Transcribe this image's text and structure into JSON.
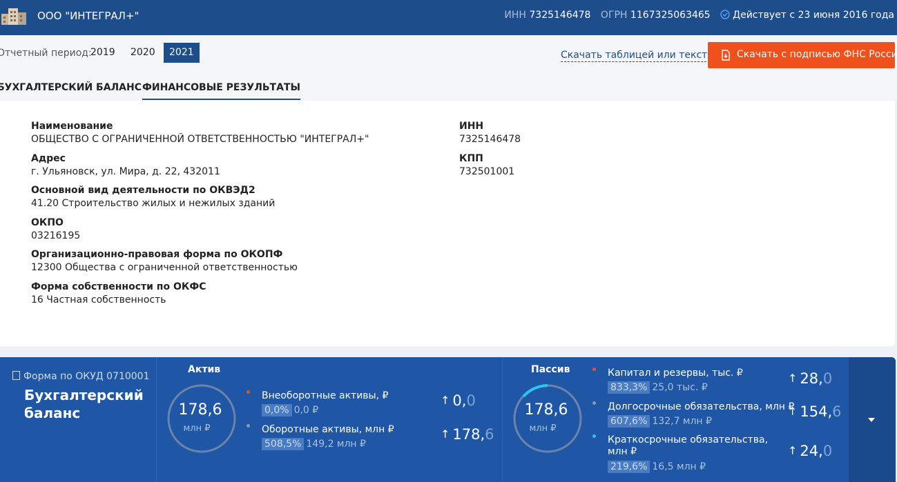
{
  "header": {
    "company": "ООО \"ИНТЕГРАЛ+\"",
    "inn_label": "ИНН",
    "inn": "7325146478",
    "ogrn_label": "ОГРН",
    "ogrn": "1167325063465",
    "status": "Действует с 23 июня 2016 года"
  },
  "period": {
    "label": "Отчетный период:",
    "years": [
      "2019",
      "2020",
      "2021"
    ],
    "selected": "2021"
  },
  "downloads": {
    "link": "Скачать таблицей или текстом",
    "button": "Скачать с подписью ФНС России"
  },
  "tabs": [
    "БУХГАЛТЕРСКИЙ БАЛАНС",
    "ФИНАНСОВЫЕ РЕЗУЛЬТАТЫ"
  ],
  "active_tab": "ФИНАНСОВЫЕ РЕЗУЛЬТАТЫ",
  "details": {
    "left": [
      {
        "label": "Наименование",
        "value": "ОБЩЕСТВО С ОГРАНИЧЕННОЙ ОТВЕТСТВЕННОСТЬЮ \"ИНТЕГРАЛ+\""
      },
      {
        "label": "Адрес",
        "value": "г. Ульяновск, ул. Мира, д. 22, 432011"
      },
      {
        "label": "Основной вид деятельности по ОКВЭД2",
        "value": "41.20 Строительство жилых и нежилых зданий"
      },
      {
        "label": "ОКПО",
        "value": "03216195"
      },
      {
        "label": "Организационно-правовая форма по ОКОПФ",
        "value": "12300 Общества с ограниченной ответственностью"
      },
      {
        "label": "Форма собственности по ОКФС",
        "value": "16 Частная собственность"
      }
    ],
    "right": [
      {
        "label": "ИНН",
        "value": "7325146478"
      },
      {
        "label": "КПП",
        "value": "732501001"
      }
    ]
  },
  "balance": {
    "form": "Форма по ОКУД 0710001",
    "title": "Бухгалтерский баланс",
    "aktiv": {
      "title": "Актив",
      "total": "178,6",
      "unit": "млн ₽",
      "items": [
        {
          "label": "Внеоборотные активы, ₽",
          "pct": "0,0%",
          "prev": "0,0 ₽",
          "big_int": "0,",
          "big_frac": "0",
          "dot_color": "#f0501c"
        },
        {
          "label": "Оборотные активы, млн ₽",
          "pct": "508,5%",
          "prev": "149,2 млн ₽",
          "big_int": "178,",
          "big_frac": "6",
          "dot_color": "#8a9ab5"
        }
      ]
    },
    "passiv": {
      "title": "Пассив",
      "total": "178,6",
      "unit": "млн ₽",
      "items": [
        {
          "label": "Капитал и резервы, тыс. ₽",
          "pct": "833,3%",
          "prev": "25,0 тыс. ₽",
          "big_int": "28,",
          "big_frac": "0",
          "dot_color": "#f0501c"
        },
        {
          "label": "Долгосрочные обязательства, млн ₽",
          "pct": "607,6%",
          "prev": "132,7 млн ₽",
          "big_int": "154,",
          "big_frac": "6",
          "dot_color": "#8a9ab5"
        },
        {
          "label": "Краткосрочные обязательства, млн ₽",
          "pct": "219,6%",
          "prev": "16,5 млн ₽",
          "big_int": "24,",
          "big_frac": "0",
          "dot_color": "#2ec4f0"
        }
      ]
    }
  }
}
